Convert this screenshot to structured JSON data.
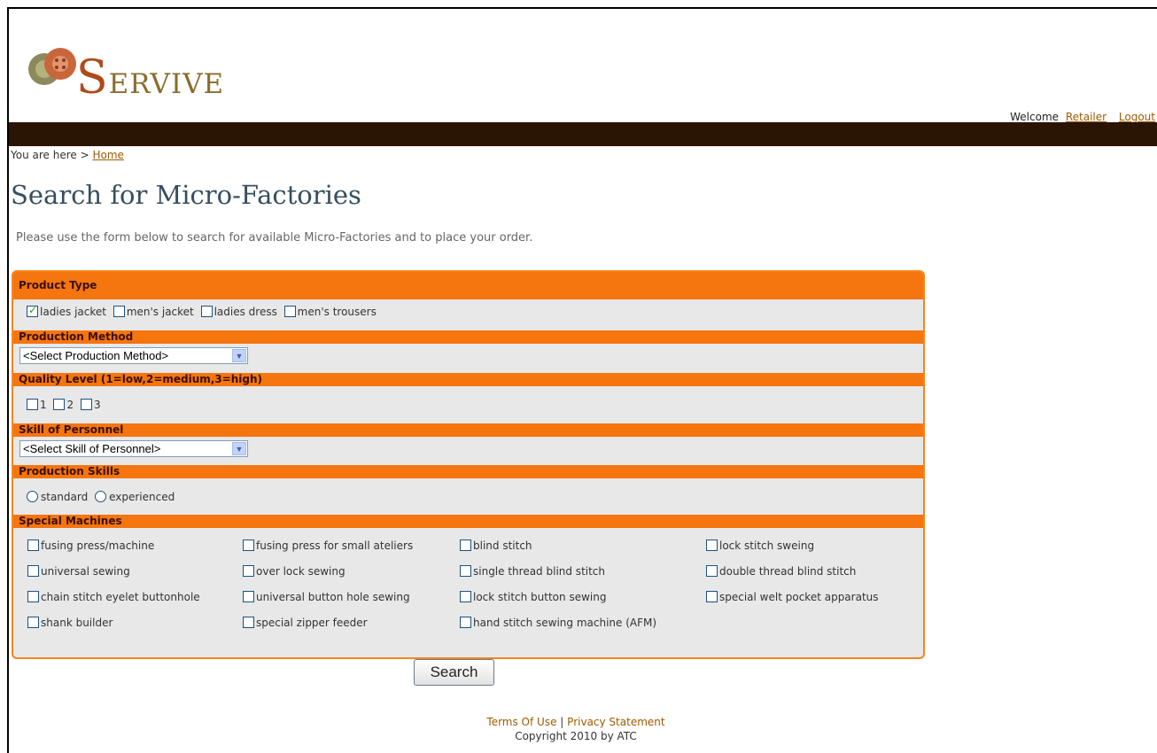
{
  "header": {
    "logo_text": "SERVIVE",
    "welcome_text": "Welcome",
    "user_link": "Retailer",
    "logout_link": "Logout"
  },
  "breadcrumb": {
    "prefix": "You are here >",
    "home": "Home"
  },
  "page": {
    "title": "Search for Micro-Factories",
    "intro": "Please use the form below to search for available Micro-Factories and to place your order."
  },
  "form": {
    "product_type": {
      "label": "Product Type",
      "options": [
        {
          "label": "ladies jacket",
          "checked": true
        },
        {
          "label": "men's jacket",
          "checked": false
        },
        {
          "label": "ladies dress",
          "checked": false
        },
        {
          "label": "men's trousers",
          "checked": false
        }
      ]
    },
    "production_method": {
      "label": "Production Method",
      "selected": "<Select Production Method>"
    },
    "quality_level": {
      "label": "Quality Level (1=low,2=medium,3=high)",
      "options": [
        "1",
        "2",
        "3"
      ]
    },
    "skill_of_personnel": {
      "label": "Skill of Personnel",
      "selected": "<Select Skill of Personnel>"
    },
    "production_skills": {
      "label": "Production Skills",
      "options": [
        "standard",
        "experienced"
      ]
    },
    "special_machines": {
      "label": "Special Machines",
      "options": [
        "fusing press/machine",
        "fusing press for small ateliers",
        "blind stitch",
        "lock stitch sweing",
        "universal sewing",
        "over lock sewing",
        "single thread blind stitch",
        "double thread blind stitch",
        "chain stitch eyelet buttonhole",
        "universal button hole sewing",
        "lock stitch button sewing",
        "special welt pocket apparatus",
        "shank builder",
        "special zipper feeder",
        "hand stitch sewing machine (AFM)"
      ]
    },
    "search_button": "Search"
  },
  "footer": {
    "terms": "Terms Of Use",
    "separator": "|",
    "privacy": "Privacy Statement",
    "copyright": "Copyright 2010 by ATC"
  },
  "colors": {
    "accent": "#f5750f",
    "topbar": "#2a1505",
    "link": "#a05a00",
    "title": "#354f5e"
  }
}
